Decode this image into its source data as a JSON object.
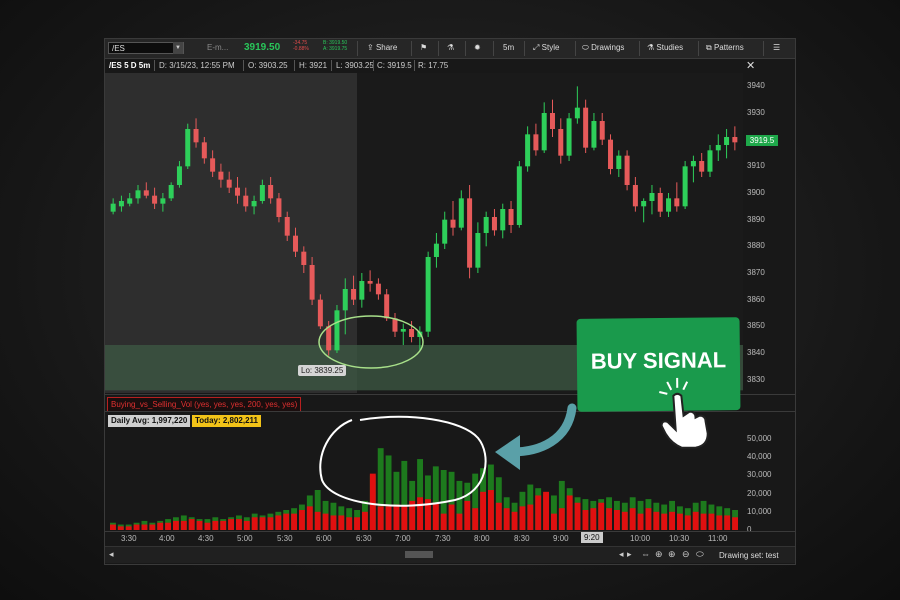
{
  "toolbar": {
    "symbol": "/ES",
    "description": "E-m...",
    "last_price": "3919.50",
    "change": "-34.75",
    "change_pct": "-0.88%",
    "bid": "B: 3919.50",
    "ask": "A: 3919.75",
    "share_label": "Share",
    "interval_label": "5m",
    "style_label": "Style",
    "drawings_label": "Drawings",
    "studies_label": "Studies",
    "patterns_label": "Patterns"
  },
  "info_bar": {
    "symbol_period": "/ES 5 D 5m",
    "date": "D: 3/15/23, 12:55 PM",
    "open": "O: 3903.25",
    "high": "H: 3921",
    "low": "L: 3903.25",
    "close": "C: 3919.5",
    "range": "R: 17.75"
  },
  "price_axis": {
    "ticks": [
      "3940",
      "3930",
      "3920",
      "3910",
      "3900",
      "3890",
      "3880",
      "3870",
      "3860",
      "3850",
      "3840",
      "3830"
    ],
    "current_tag": "3919.5"
  },
  "low_label": "Lo: 3839.25",
  "volume_study": {
    "title": "Buying_vs_Selling_Vol (yes, yes, yes, 200, yes, yes)",
    "daily_avg": "Daily Avg: 1,997,220",
    "today": "Today: 2,802,211",
    "ticks": [
      "50,000",
      "40,000",
      "30,000",
      "20,000",
      "10,000",
      "0"
    ]
  },
  "time_axis": {
    "ticks": [
      "3:30",
      "4:00",
      "4:30",
      "5:00",
      "5:30",
      "6:00",
      "6:30",
      "7:00",
      "7:30",
      "8:00",
      "8:30",
      "9:00",
      "10:00",
      "10:30",
      "11:00"
    ],
    "cursor": "9:20"
  },
  "bottom_bar": {
    "drawing_set": "Drawing set: test"
  },
  "callout": {
    "buy_signal": "BUY SIGNAL"
  },
  "colors": {
    "up": "#2ecf5a",
    "down": "#e65a5a",
    "buy_bg": "#1a9a4c",
    "vol_buy": "#1d7a1d",
    "vol_sell": "#e01010"
  },
  "chart_data": {
    "type": "candlestick",
    "y_range": [
      3825,
      3945
    ],
    "candles": [
      {
        "o": 3893,
        "h": 3898,
        "l": 3892,
        "c": 3896
      },
      {
        "o": 3895,
        "h": 3899,
        "l": 3893,
        "c": 3897
      },
      {
        "o": 3896,
        "h": 3900,
        "l": 3895,
        "c": 3898
      },
      {
        "o": 3898,
        "h": 3903,
        "l": 3896,
        "c": 3901
      },
      {
        "o": 3901,
        "h": 3904,
        "l": 3898,
        "c": 3899
      },
      {
        "o": 3899,
        "h": 3902,
        "l": 3894,
        "c": 3896
      },
      {
        "o": 3896,
        "h": 3900,
        "l": 3893,
        "c": 3898
      },
      {
        "o": 3898,
        "h": 3904,
        "l": 3897,
        "c": 3903
      },
      {
        "o": 3903,
        "h": 3912,
        "l": 3902,
        "c": 3910
      },
      {
        "o": 3910,
        "h": 3926,
        "l": 3909,
        "c": 3924
      },
      {
        "o": 3924,
        "h": 3928,
        "l": 3917,
        "c": 3919
      },
      {
        "o": 3919,
        "h": 3921,
        "l": 3911,
        "c": 3913
      },
      {
        "o": 3913,
        "h": 3916,
        "l": 3906,
        "c": 3908
      },
      {
        "o": 3908,
        "h": 3911,
        "l": 3902,
        "c": 3905
      },
      {
        "o": 3905,
        "h": 3908,
        "l": 3900,
        "c": 3902
      },
      {
        "o": 3902,
        "h": 3906,
        "l": 3896,
        "c": 3899
      },
      {
        "o": 3899,
        "h": 3902,
        "l": 3893,
        "c": 3895
      },
      {
        "o": 3895,
        "h": 3899,
        "l": 3892,
        "c": 3897
      },
      {
        "o": 3897,
        "h": 3905,
        "l": 3896,
        "c": 3903
      },
      {
        "o": 3903,
        "h": 3906,
        "l": 3896,
        "c": 3898
      },
      {
        "o": 3898,
        "h": 3900,
        "l": 3889,
        "c": 3891
      },
      {
        "o": 3891,
        "h": 3893,
        "l": 3882,
        "c": 3884
      },
      {
        "o": 3884,
        "h": 3887,
        "l": 3876,
        "c": 3878
      },
      {
        "o": 3878,
        "h": 3880,
        "l": 3870,
        "c": 3873
      },
      {
        "o": 3873,
        "h": 3876,
        "l": 3858,
        "c": 3860
      },
      {
        "o": 3860,
        "h": 3862,
        "l": 3849,
        "c": 3850
      },
      {
        "o": 3850,
        "h": 3852,
        "l": 3839,
        "c": 3841
      },
      {
        "o": 3841,
        "h": 3858,
        "l": 3840,
        "c": 3856
      },
      {
        "o": 3856,
        "h": 3868,
        "l": 3847,
        "c": 3864
      },
      {
        "o": 3864,
        "h": 3869,
        "l": 3858,
        "c": 3860
      },
      {
        "o": 3860,
        "h": 3870,
        "l": 3857,
        "c": 3867
      },
      {
        "o": 3867,
        "h": 3871,
        "l": 3863,
        "c": 3866
      },
      {
        "o": 3866,
        "h": 3868,
        "l": 3860,
        "c": 3862
      },
      {
        "o": 3862,
        "h": 3864,
        "l": 3852,
        "c": 3853
      },
      {
        "o": 3853,
        "h": 3855,
        "l": 3846,
        "c": 3848
      },
      {
        "o": 3848,
        "h": 3851,
        "l": 3843,
        "c": 3849
      },
      {
        "o": 3849,
        "h": 3852,
        "l": 3844,
        "c": 3846
      },
      {
        "o": 3846,
        "h": 3850,
        "l": 3841,
        "c": 3848
      },
      {
        "o": 3848,
        "h": 3878,
        "l": 3846,
        "c": 3876
      },
      {
        "o": 3876,
        "h": 3885,
        "l": 3872,
        "c": 3881
      },
      {
        "o": 3881,
        "h": 3893,
        "l": 3879,
        "c": 3890
      },
      {
        "o": 3890,
        "h": 3897,
        "l": 3884,
        "c": 3887
      },
      {
        "o": 3887,
        "h": 3901,
        "l": 3886,
        "c": 3898
      },
      {
        "o": 3898,
        "h": 3903,
        "l": 3868,
        "c": 3872
      },
      {
        "o": 3872,
        "h": 3889,
        "l": 3870,
        "c": 3885
      },
      {
        "o": 3885,
        "h": 3893,
        "l": 3880,
        "c": 3891
      },
      {
        "o": 3891,
        "h": 3894,
        "l": 3884,
        "c": 3886
      },
      {
        "o": 3886,
        "h": 3896,
        "l": 3883,
        "c": 3894
      },
      {
        "o": 3894,
        "h": 3897,
        "l": 3885,
        "c": 3888
      },
      {
        "o": 3888,
        "h": 3912,
        "l": 3887,
        "c": 3910
      },
      {
        "o": 3910,
        "h": 3925,
        "l": 3908,
        "c": 3922
      },
      {
        "o": 3922,
        "h": 3926,
        "l": 3914,
        "c": 3916
      },
      {
        "o": 3916,
        "h": 3934,
        "l": 3915,
        "c": 3930
      },
      {
        "o": 3930,
        "h": 3935,
        "l": 3921,
        "c": 3924
      },
      {
        "o": 3924,
        "h": 3928,
        "l": 3911,
        "c": 3914
      },
      {
        "o": 3914,
        "h": 3930,
        "l": 3912,
        "c": 3928
      },
      {
        "o": 3928,
        "h": 3940,
        "l": 3926,
        "c": 3932
      },
      {
        "o": 3932,
        "h": 3935,
        "l": 3915,
        "c": 3917
      },
      {
        "o": 3917,
        "h": 3930,
        "l": 3916,
        "c": 3927
      },
      {
        "o": 3927,
        "h": 3930,
        "l": 3918,
        "c": 3920
      },
      {
        "o": 3920,
        "h": 3922,
        "l": 3907,
        "c": 3909
      },
      {
        "o": 3909,
        "h": 3916,
        "l": 3906,
        "c": 3914
      },
      {
        "o": 3914,
        "h": 3916,
        "l": 3901,
        "c": 3903
      },
      {
        "o": 3903,
        "h": 3906,
        "l": 3893,
        "c": 3895
      },
      {
        "o": 3895,
        "h": 3898,
        "l": 3889,
        "c": 3897
      },
      {
        "o": 3897,
        "h": 3903,
        "l": 3892,
        "c": 3900
      },
      {
        "o": 3900,
        "h": 3902,
        "l": 3891,
        "c": 3893
      },
      {
        "o": 3893,
        "h": 3900,
        "l": 3891,
        "c": 3898
      },
      {
        "o": 3898,
        "h": 3904,
        "l": 3893,
        "c": 3895
      },
      {
        "o": 3895,
        "h": 3912,
        "l": 3894,
        "c": 3910
      },
      {
        "o": 3910,
        "h": 3914,
        "l": 3904,
        "c": 3912
      },
      {
        "o": 3912,
        "h": 3915,
        "l": 3906,
        "c": 3908
      },
      {
        "o": 3908,
        "h": 3918,
        "l": 3906,
        "c": 3916
      },
      {
        "o": 3916,
        "h": 3922,
        "l": 3912,
        "c": 3918
      },
      {
        "o": 3918,
        "h": 3924,
        "l": 3913,
        "c": 3921
      },
      {
        "o": 3921,
        "h": 3925,
        "l": 3916,
        "c": 3919
      }
    ],
    "volume_buy": [
      4,
      3,
      3,
      4,
      5,
      4,
      5,
      6,
      7,
      8,
      7,
      6,
      6,
      7,
      6,
      7,
      8,
      7,
      9,
      8,
      9,
      10,
      11,
      12,
      14,
      19,
      22,
      16,
      15,
      13,
      12,
      11,
      16,
      30,
      45,
      41,
      32,
      38,
      27,
      39,
      30,
      35,
      33,
      32,
      27,
      26,
      31,
      34,
      36,
      29,
      18,
      15,
      21,
      25,
      23,
      20,
      19,
      27,
      23,
      18,
      17,
      16,
      17,
      18,
      16,
      15,
      18,
      16,
      17,
      15,
      14,
      16,
      13,
      12,
      15,
      16,
      14,
      13,
      12,
      11
    ],
    "volume_sell": [
      3,
      2,
      2,
      3,
      3,
      3,
      4,
      4,
      5,
      5,
      6,
      5,
      4,
      5,
      5,
      6,
      6,
      5,
      7,
      7,
      7,
      8,
      9,
      9,
      11,
      13,
      10,
      9,
      8,
      8,
      7,
      7,
      10,
      31,
      13,
      13,
      14,
      13,
      16,
      18,
      17,
      15,
      9,
      14,
      9,
      16,
      12,
      21,
      22,
      15,
      12,
      10,
      13,
      14,
      19,
      21,
      9,
      12,
      19,
      15,
      11,
      12,
      15,
      12,
      11,
      10,
      12,
      9,
      12,
      10,
      9,
      10,
      9,
      8,
      10,
      9,
      9,
      8,
      8,
      7
    ],
    "volume_ylim": [
      0,
      55000
    ]
  }
}
